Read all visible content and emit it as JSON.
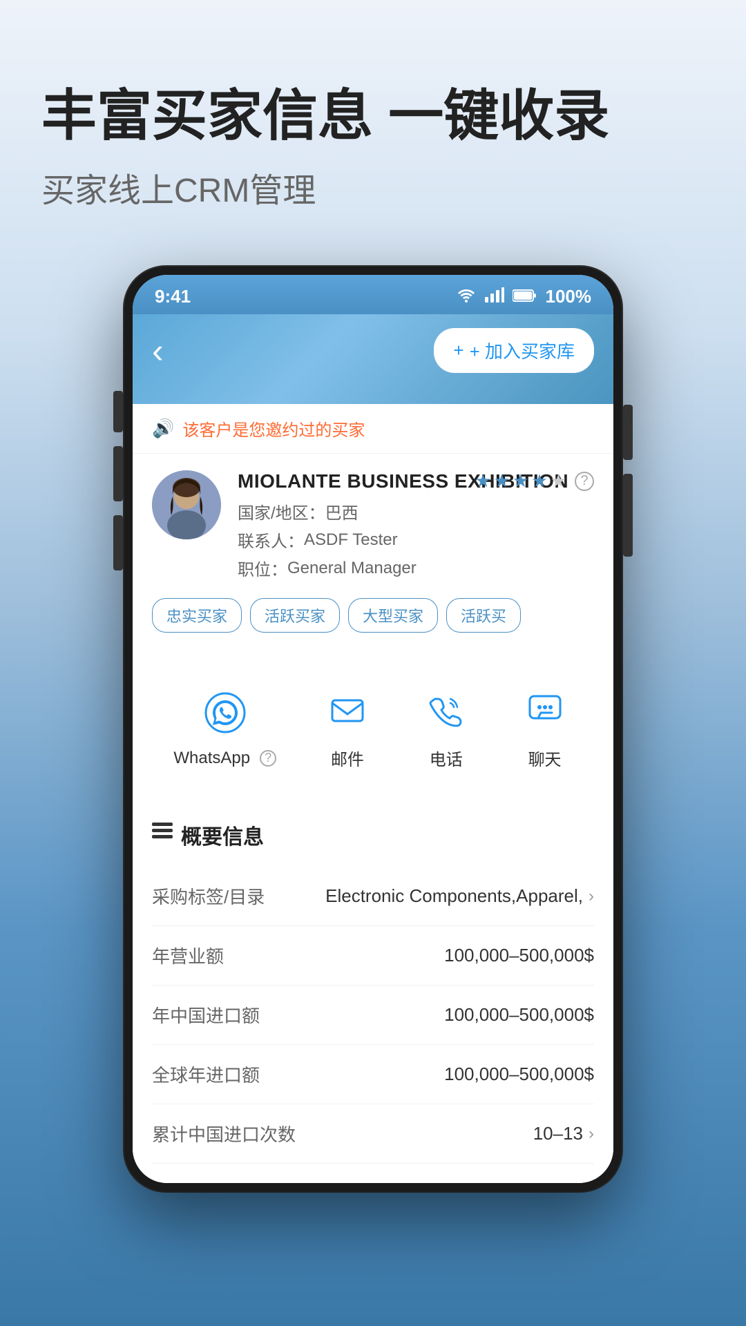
{
  "hero": {
    "title": "丰富买家信息 一键收录",
    "subtitle": "买家线上CRM管理"
  },
  "phone": {
    "statusBar": {
      "time": "9:41",
      "battery": "100%"
    },
    "header": {
      "backLabel": "‹",
      "addBuyerLabel": "+ 加入买家库"
    },
    "noticeBanner": {
      "text": "该客户是您邀约过的买家"
    },
    "businessCard": {
      "companyName": "MIOLANTE BUSINESS EXHIBITION",
      "countryLabel": "国家/地区：",
      "country": "巴西",
      "contactLabel": "联系人：",
      "contact": "ASDF Tester",
      "positionLabel": "职位：",
      "position": "General Manager",
      "stars": 4,
      "maxStars": 5,
      "tags": [
        "忠实买家",
        "活跃买家",
        "大型买家",
        "活跃买"
      ]
    },
    "contactActions": [
      {
        "id": "whatsapp",
        "label": "WhatsApp",
        "hasHelp": true
      },
      {
        "id": "email",
        "label": "邮件",
        "hasHelp": false
      },
      {
        "id": "phone",
        "label": "电话",
        "hasHelp": false
      },
      {
        "id": "chat",
        "label": "聊天",
        "hasHelp": false
      }
    ],
    "overview": {
      "sectionTitle": "概要信息",
      "items": [
        {
          "label": "采购标签/目录",
          "value": "Electronic Components,Apparel,",
          "hasChevron": true
        },
        {
          "label": "年营业额",
          "value": "100,000–500,000$",
          "hasChevron": false
        },
        {
          "label": "年中国进口额",
          "value": "100,000–500,000$",
          "hasChevron": false
        },
        {
          "label": "全球年进口额",
          "value": "100,000–500,000$",
          "hasChevron": false
        },
        {
          "label": "累计中国进口次数",
          "value": "10–13",
          "hasChevron": true
        }
      ]
    }
  }
}
